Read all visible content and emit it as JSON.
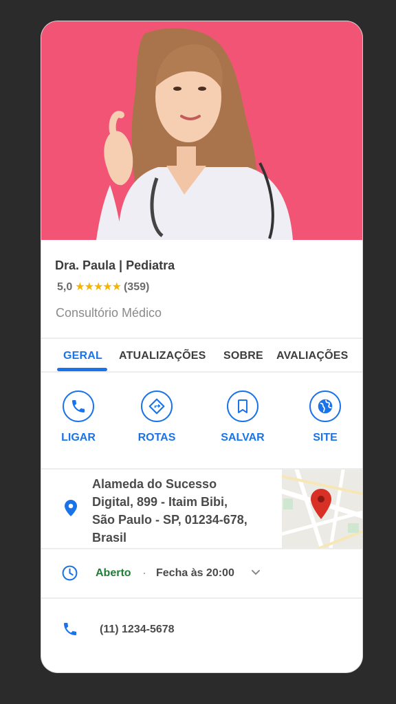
{
  "profile": {
    "name": "Dra. Paula | Pediatra",
    "rating_value": "5,0",
    "stars": "★★★★★",
    "reviews_count": "(359)",
    "category": "Consultório Médico"
  },
  "tabs": [
    {
      "label": "GERAL",
      "active": true
    },
    {
      "label": "ATUALIZAÇÕES",
      "active": false
    },
    {
      "label": "SOBRE",
      "active": false
    },
    {
      "label": "AVALIAÇÕES",
      "active": false
    }
  ],
  "actions": [
    {
      "label": "LIGAR",
      "icon": "phone-icon"
    },
    {
      "label": "ROTAS",
      "icon": "directions-icon"
    },
    {
      "label": "SALVAR",
      "icon": "bookmark-icon"
    },
    {
      "label": "SITE",
      "icon": "globe-icon"
    }
  ],
  "address": {
    "lines": [
      "Alameda do Sucesso",
      "Digital, 899 -  Itaim Bibi,",
      "São Paulo - SP, 01234-678,",
      "Brasil"
    ],
    "icon": "location-pin-icon"
  },
  "hours": {
    "status": "Aberto",
    "dot": "·",
    "closing": "Fecha às 20:00",
    "icon": "clock-icon"
  },
  "phone": {
    "number": "(11) 1234-5678",
    "icon": "phone-icon"
  },
  "colors": {
    "accent": "#1a73e8",
    "open_green": "#1e7e34",
    "star": "#f5b400",
    "hero_bg": "#f25475",
    "page_bg": "#2b2b2b"
  }
}
